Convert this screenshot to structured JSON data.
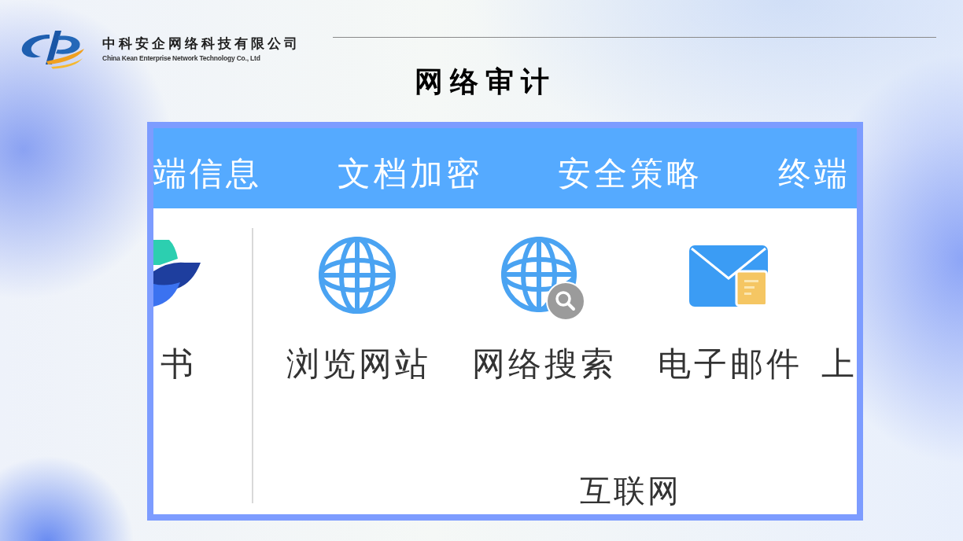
{
  "header": {
    "company_name": "中科安企网络科技有限公司",
    "company_name_en": "China Kean Enterprise Network Technology Co., Ltd"
  },
  "title": "网络审计",
  "screenshot": {
    "tabs": [
      {
        "label": "端信息"
      },
      {
        "label": "文档加密"
      },
      {
        "label": "安全策略"
      },
      {
        "label": "终端"
      }
    ],
    "ribbon": {
      "cut_left_item": {
        "label": "书"
      },
      "items": [
        {
          "kind": "globe",
          "label": "浏览网站"
        },
        {
          "kind": "globe-search",
          "label": "网络搜索"
        },
        {
          "kind": "mail",
          "label": "电子邮件"
        }
      ],
      "cut_right_item": {
        "label": "上"
      },
      "group_label": "互联网"
    }
  }
}
